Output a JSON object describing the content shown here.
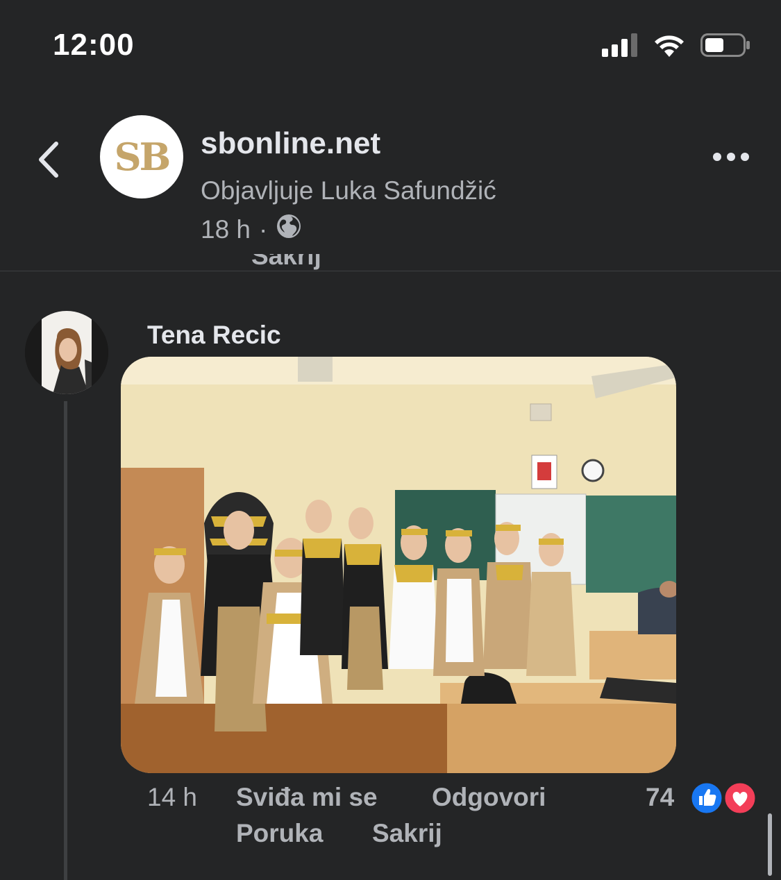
{
  "status_bar": {
    "time": "12:00",
    "signal_icon": "cellular-signal-icon",
    "wifi_icon": "wifi-icon",
    "battery_icon": "battery-icon"
  },
  "header": {
    "back_icon": "chevron-left-icon",
    "avatar_text": "SB",
    "page_name": "sbonline.net",
    "posted_by": "Objavljuje Luka Safundžić",
    "time": "18 h",
    "separator": "·",
    "privacy_icon": "globe-icon",
    "more_icon": "more-horizontal-icon"
  },
  "clipped_above": {
    "hide_label": "Sakrij"
  },
  "comment": {
    "author": "Tena Recic",
    "photo_description_icon": "comment-photo",
    "time": "14 h",
    "like_label": "Sviđa mi se",
    "reply_label": "Odgovori",
    "message_label": "Poruka",
    "hide_label": "Sakrij",
    "reaction_count": "74",
    "reactions": [
      "like-reaction-icon",
      "love-reaction-icon"
    ]
  },
  "colors": {
    "background": "#242526",
    "primary_text": "#e4e6eb",
    "secondary_text": "#b0b3b8",
    "like_blue": "#1877f2",
    "love_red": "#f33e58",
    "brand_gold": "#c5a56a"
  }
}
